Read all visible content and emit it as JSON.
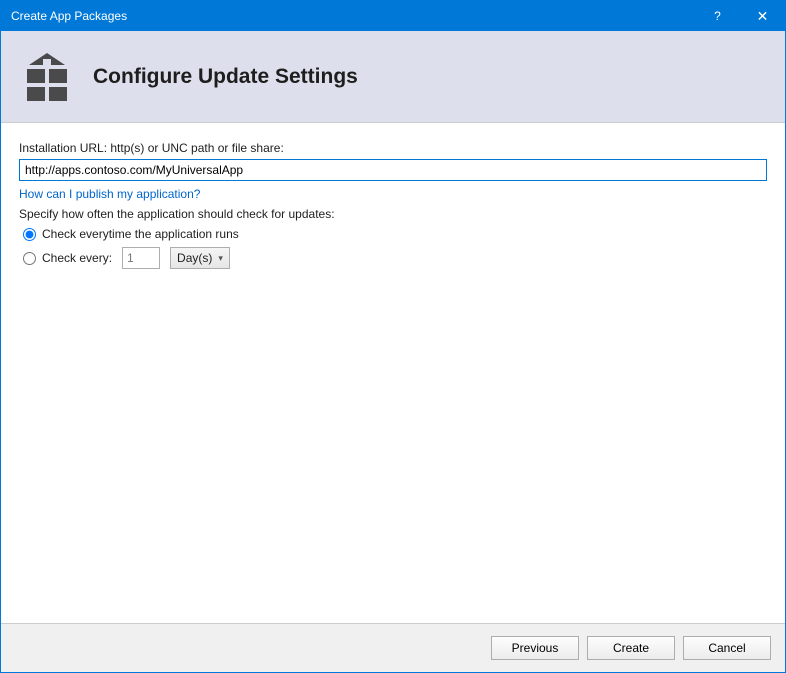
{
  "window": {
    "title": "Create App Packages",
    "help_symbol": "?",
    "close_symbol": "✕"
  },
  "header": {
    "title": "Configure Update Settings"
  },
  "form": {
    "installation_url_label": "Installation URL: http(s) or UNC path or file share:",
    "installation_url_value": "http://apps.contoso.com/MyUniversalApp",
    "help_link": "How can I publish my application?",
    "update_frequency_label": "Specify how often the application should check for updates:",
    "option_every_run": "Check everytime the application runs",
    "option_every_interval": "Check every:",
    "interval_value": "1",
    "interval_unit": "Day(s)"
  },
  "footer": {
    "previous": "Previous",
    "create": "Create",
    "cancel": "Cancel"
  }
}
